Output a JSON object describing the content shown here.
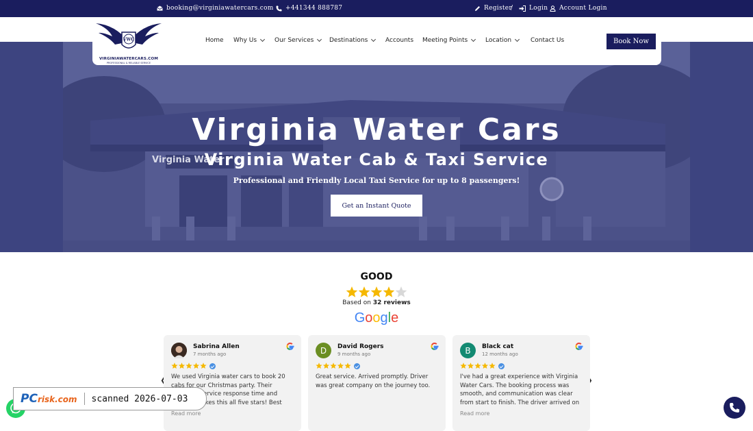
{
  "topbar": {
    "email": "booking@virginiawatercars.com",
    "phone": "+441344 888787",
    "register": "Register",
    "separator": "/",
    "login": "Login",
    "account_login": "Account Login"
  },
  "logo": {
    "name": "VIRGINIAWATERCARS.COM",
    "tagline": "PROFESSIONAL & RELIABLE SERVICE",
    "emblem_letters": "VWC"
  },
  "nav": {
    "items": [
      {
        "label": "Home",
        "dropdown": false
      },
      {
        "label": "Why Us",
        "dropdown": true
      },
      {
        "label": "Our Services",
        "dropdown": true
      },
      {
        "label": "Destinations",
        "dropdown": true
      },
      {
        "label": "Accounts",
        "dropdown": false
      },
      {
        "label": "Meeting Points",
        "dropdown": true
      },
      {
        "label": "Location",
        "dropdown": true
      },
      {
        "label": "Contact Us",
        "dropdown": false
      }
    ],
    "book_now": "Book Now"
  },
  "hero": {
    "title": "Virginia Water Cars",
    "subtitle": "Virginia Water Cab & Taxi Service",
    "tagline": "Professional and Friendly Local Taxi Service for up to 8 passengers!",
    "quote_button": "Get an Instant Quote",
    "station_sign": "Virginia Water"
  },
  "reviews_summary": {
    "rating_word": "GOOD",
    "stars": 4.5,
    "based_on_prefix": "Based on",
    "review_count": "32 reviews",
    "provider": "Google"
  },
  "reviews": [
    {
      "name": "Sabrina Allen",
      "time": "7 months ago",
      "stars": 5,
      "text": "We used Virginia water cars to book 20 cabs for our Christmas party. Their customer service response time and attitude makes this all five stars! Best",
      "read_more": "Read more",
      "avatar_initial": "",
      "avatar_color": "#5a3b2e"
    },
    {
      "name": "David Rogers",
      "time": "9 months ago",
      "stars": 5,
      "text": "Great service. Arrived promptly. Driver was great company on the journey too.",
      "read_more": "",
      "avatar_initial": "D",
      "avatar_color": "#6b8e23"
    },
    {
      "name": "Black cat",
      "time": "12 months ago",
      "stars": 5,
      "text": "I've had a great experience with Virginia Water Cars. The booking process was smooth, and communication was clear from start to finish. The driver arrived on",
      "read_more": "Read more",
      "avatar_initial": "B",
      "avatar_color": "#138a72"
    }
  ],
  "watermark": {
    "brand": "PC",
    "brand_suffix": "risk.com",
    "scanned": "scanned 2026-07-03"
  },
  "colors": {
    "navy": "#1a1d5e",
    "star": "#f5b800",
    "whatsapp": "#25d366"
  }
}
